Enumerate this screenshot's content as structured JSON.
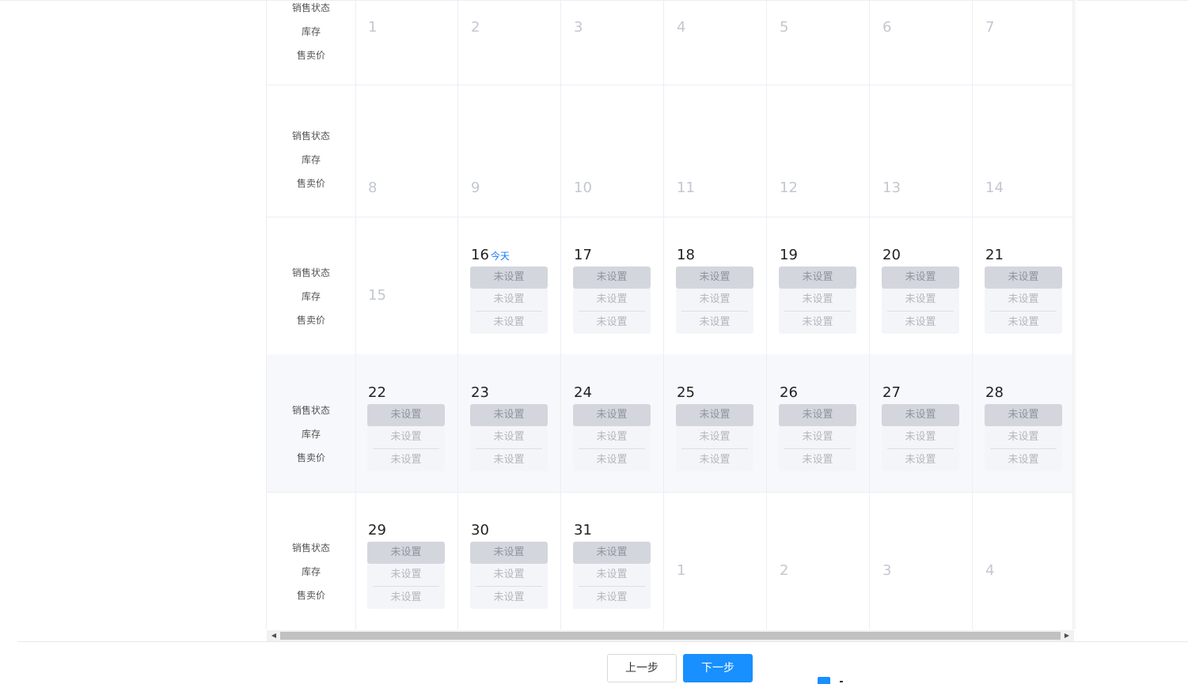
{
  "labels": [
    "销售状态",
    "库存",
    "售卖价"
  ],
  "today_label": "今天",
  "unset_label": "未设置",
  "buttons": {
    "prev": "上一步",
    "next": "下一步"
  },
  "weeks": [
    [
      {
        "day": "1",
        "muted": true
      },
      {
        "day": "2",
        "muted": true
      },
      {
        "day": "3",
        "muted": true
      },
      {
        "day": "4",
        "muted": true
      },
      {
        "day": "5",
        "muted": true
      },
      {
        "day": "6",
        "muted": true
      },
      {
        "day": "7",
        "muted": true
      }
    ],
    [
      {
        "day": "8",
        "muted": true
      },
      {
        "day": "9",
        "muted": true
      },
      {
        "day": "10",
        "muted": true
      },
      {
        "day": "11",
        "muted": true
      },
      {
        "day": "12",
        "muted": true
      },
      {
        "day": "13",
        "muted": true
      },
      {
        "day": "14",
        "muted": true
      }
    ],
    [
      {
        "day": "15",
        "muted": true
      },
      {
        "day": "16",
        "today": true,
        "status": "未设置",
        "stock": "未设置",
        "price": "未设置"
      },
      {
        "day": "17",
        "status": "未设置",
        "stock": "未设置",
        "price": "未设置"
      },
      {
        "day": "18",
        "status": "未设置",
        "stock": "未设置",
        "price": "未设置"
      },
      {
        "day": "19",
        "status": "未设置",
        "stock": "未设置",
        "price": "未设置"
      },
      {
        "day": "20",
        "status": "未设置",
        "stock": "未设置",
        "price": "未设置"
      },
      {
        "day": "21",
        "status": "未设置",
        "stock": "未设置",
        "price": "未设置"
      }
    ],
    [
      {
        "day": "22",
        "status": "未设置",
        "stock": "未设置",
        "price": "未设置"
      },
      {
        "day": "23",
        "status": "未设置",
        "stock": "未设置",
        "price": "未设置"
      },
      {
        "day": "24",
        "status": "未设置",
        "stock": "未设置",
        "price": "未设置"
      },
      {
        "day": "25",
        "status": "未设置",
        "stock": "未设置",
        "price": "未设置"
      },
      {
        "day": "26",
        "status": "未设置",
        "stock": "未设置",
        "price": "未设置"
      },
      {
        "day": "27",
        "status": "未设置",
        "stock": "未设置",
        "price": "未设置"
      },
      {
        "day": "28",
        "status": "未设置",
        "stock": "未设置",
        "price": "未设置"
      }
    ],
    [
      {
        "day": "29",
        "status": "未设置",
        "stock": "未设置",
        "price": "未设置"
      },
      {
        "day": "30",
        "status": "未设置",
        "stock": "未设置",
        "price": "未设置"
      },
      {
        "day": "31",
        "status": "未设置",
        "stock": "未设置",
        "price": "未设置"
      },
      {
        "day": "1",
        "muted": true
      },
      {
        "day": "2",
        "muted": true
      },
      {
        "day": "3",
        "muted": true
      },
      {
        "day": "4",
        "muted": true
      }
    ]
  ],
  "colors": {
    "primary": "#1890ff",
    "today_text": "#1677ff",
    "status_pill": "#d3d6dd",
    "row_highlight": "#f7f8fb"
  },
  "icons": {
    "scroll_left": "triangle-left-icon",
    "scroll_right": "triangle-right-icon"
  }
}
